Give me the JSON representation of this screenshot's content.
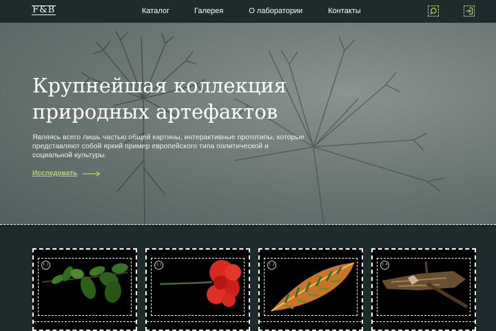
{
  "header": {
    "logo": "F&B",
    "nav": [
      {
        "label": "Каталог"
      },
      {
        "label": "Галерея"
      },
      {
        "label": "О лаборатории"
      },
      {
        "label": "Контакты"
      }
    ],
    "icons": [
      "search-icon",
      "login-icon"
    ],
    "accent_color": "#b5d46a"
  },
  "hero": {
    "title_line1": "Крупнейшая коллекция",
    "title_line2": "природных артефактов",
    "description": "Являясь всего лишь частью общей картины, интерактивные прототипы, которые представляют собой яркий пример европейского типа политической и социальной культуры.",
    "cta_label": "Исследовать"
  },
  "cards": [
    {
      "number": "1.1",
      "subject": "green-leaves-branch"
    },
    {
      "number": "3.1",
      "subject": "red-flower"
    },
    {
      "number": "1.2",
      "subject": "croton-leaf"
    },
    {
      "number": "1.4",
      "subject": "wood-piece"
    }
  ]
}
